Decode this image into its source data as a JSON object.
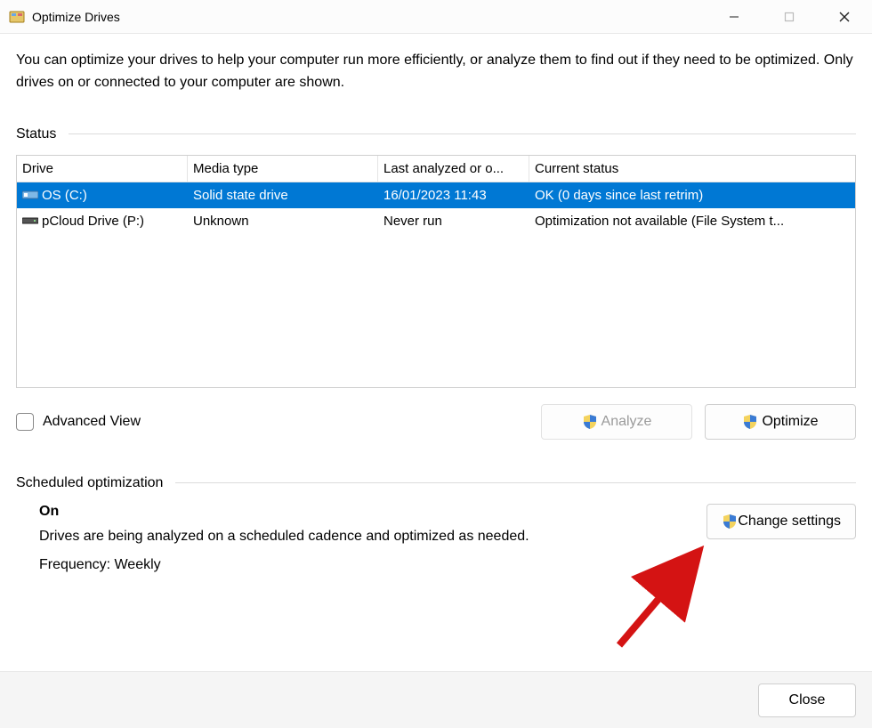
{
  "window": {
    "title": "Optimize Drives"
  },
  "intro": "You can optimize your drives to help your computer run more efficiently, or analyze them to find out if they need to be optimized. Only drives on or connected to your computer are shown.",
  "status": {
    "label": "Status",
    "columns": [
      "Drive",
      "Media type",
      "Last analyzed or o...",
      "Current status"
    ],
    "rows": [
      {
        "icon": "ssd-icon",
        "name": "OS (C:)",
        "media": "Solid state drive",
        "last": "16/01/2023 11:43",
        "status": "OK (0 days since last retrim)",
        "selected": true
      },
      {
        "icon": "hdd-icon",
        "name": "pCloud Drive (P:)",
        "media": "Unknown",
        "last": "Never run",
        "status": "Optimization not available (File System t...",
        "selected": false
      }
    ]
  },
  "advanced_view_label": "Advanced View",
  "buttons": {
    "analyze": "Analyze",
    "optimize": "Optimize",
    "change_settings": "Change settings",
    "close": "Close"
  },
  "scheduled": {
    "label": "Scheduled optimization",
    "state": "On",
    "description": "Drives are being analyzed on a scheduled cadence and optimized as needed.",
    "frequency": "Frequency: Weekly"
  }
}
